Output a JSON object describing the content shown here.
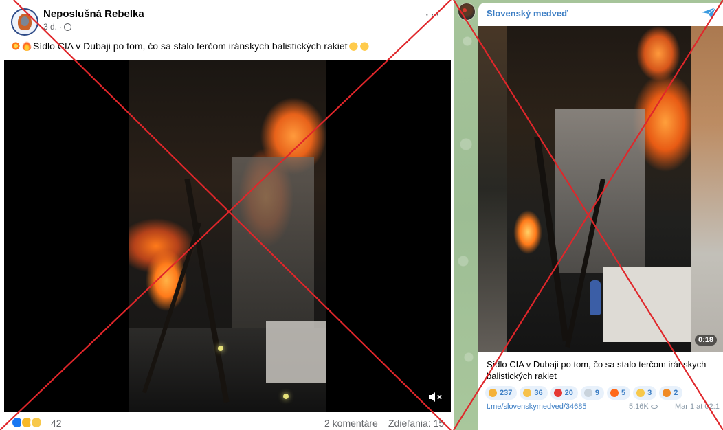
{
  "facebook": {
    "author": "Neposlušná Rebelka",
    "time": "3 d.",
    "time_separator": "·",
    "more_label": "···",
    "caption_text": "Sídlo CIA v Dubaji po tom, čo sa stalo terčom iránskych balistických rakiet",
    "caption_emojis": [
      "burst-emoji",
      "fire-emoji",
      "clap-emoji",
      "clap-emoji"
    ],
    "reaction_count": "42",
    "reaction_types": [
      "like",
      "wow",
      "sad"
    ],
    "comments": "2 komentáre",
    "shares": "Zdieľania: 15",
    "mute_icon": "muted-speaker-icon"
  },
  "telegram": {
    "channel": "Slovenský medveď",
    "duration": "0:18",
    "text": "Sídlo CIA v Dubaji po tom, čo sa stalo terčom iránskych balistických rakiet",
    "reactions": [
      {
        "emoji": "thumbs-up",
        "count": "237",
        "color": "#f4b23a"
      },
      {
        "emoji": "clap",
        "count": "36",
        "color": "#f6c14b"
      },
      {
        "emoji": "heart",
        "count": "20",
        "color": "#e53935"
      },
      {
        "emoji": "dove",
        "count": "9",
        "color": "#c9d3dc"
      },
      {
        "emoji": "fire",
        "count": "5",
        "color": "#ff6a1a"
      },
      {
        "emoji": "grin",
        "count": "3",
        "color": "#f7c84a"
      },
      {
        "emoji": "jack-o-lantern",
        "count": "2",
        "color": "#f08a24"
      }
    ],
    "link": "t.me/slovenskymedved/34685",
    "views": "5.16K",
    "date": "Mar 1 at 02:1"
  },
  "colors": {
    "cross": "#e0262a",
    "telegram_accent": "#3c7ec4",
    "facebook_like": "#1877f2"
  }
}
